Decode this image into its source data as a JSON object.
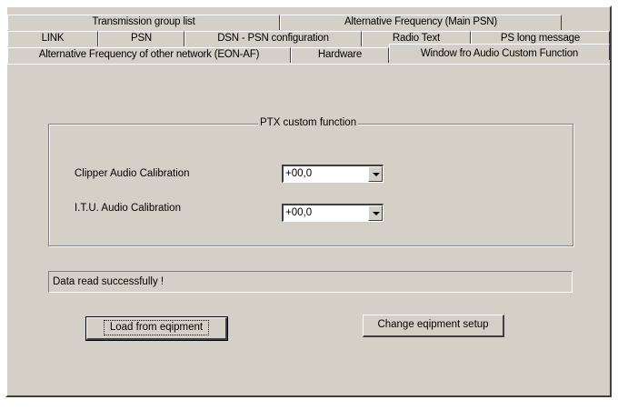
{
  "tabs": {
    "row1": [
      "Transmission group list",
      "Alternative Frequency (Main PSN)"
    ],
    "row2": [
      "LINK",
      "PSN",
      "DSN - PSN configuration",
      "Radio Text",
      "PS long message"
    ],
    "row3": [
      "Alternative Frequency of other network (EON-AF)",
      "Hardware",
      "Window fro Audio Custom Function"
    ]
  },
  "group": {
    "title": "PTX  custom function",
    "clipper_label": "Clipper Audio Calibration",
    "clipper_value": "+00,0",
    "itu_label": "I.T.U.  Audio Calibration",
    "itu_value": "+00,0"
  },
  "status_text": "Data read successfully !",
  "buttons": {
    "load": "Load from eqipment",
    "change": "Change eqipment setup"
  }
}
